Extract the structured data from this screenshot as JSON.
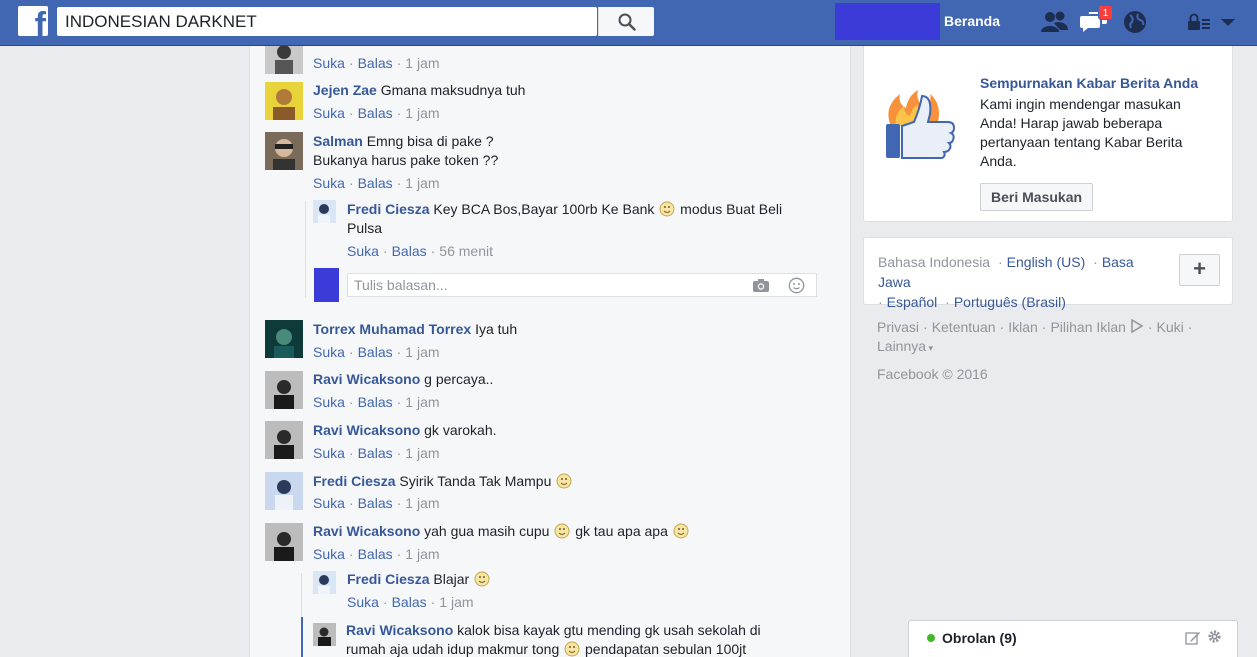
{
  "topbar": {
    "search_value": "INDONESIAN DARKNET",
    "home_label": "Beranda",
    "notification_count": "1",
    "brand_color": "#4267b2"
  },
  "comments": [
    {
      "author": "",
      "text": "",
      "actions": {
        "like": "Suka",
        "reply": "Balas",
        "time": "1 jam"
      }
    },
    {
      "author": "Jejen Zae",
      "text": "Gmana maksudnya tuh",
      "actions": {
        "like": "Suka",
        "reply": "Balas",
        "time": "1 jam"
      }
    },
    {
      "author": "Salman",
      "text": "Emng bisa di pake ?",
      "text2": "Bukanya harus pake token ??",
      "actions": {
        "like": "Suka",
        "reply": "Balas",
        "time": "1 jam"
      }
    },
    {
      "author": "Fredi Ciesza",
      "text_a": "Key BCA Bos,Bayar 100rb Ke Bank",
      "text_b": "modus Buat Beli",
      "text2": "Pulsa",
      "actions": {
        "like": "Suka",
        "reply": "Balas",
        "time": "56 menit"
      }
    },
    {
      "author": "Torrex Muhamad Torrex",
      "text": "Iya tuh",
      "actions": {
        "like": "Suka",
        "reply": "Balas",
        "time": "1 jam"
      }
    },
    {
      "author": "Ravi Wicaksono",
      "text": "g percaya..",
      "actions": {
        "like": "Suka",
        "reply": "Balas",
        "time": "1 jam"
      }
    },
    {
      "author": "Ravi Wicaksono",
      "text": "gk varokah.",
      "actions": {
        "like": "Suka",
        "reply": "Balas",
        "time": "1 jam"
      }
    },
    {
      "author": "Fredi Ciesza",
      "text": "Syirik Tanda Tak Mampu",
      "actions": {
        "like": "Suka",
        "reply": "Balas",
        "time": "1 jam"
      }
    },
    {
      "author": "Ravi Wicaksono",
      "text_a": "yah gua masih cupu",
      "text_b": "gk tau apa apa",
      "actions": {
        "like": "Suka",
        "reply": "Balas",
        "time": "1 jam"
      }
    },
    {
      "author": "Fredi Ciesza",
      "text": "Blajar",
      "actions": {
        "like": "Suka",
        "reply": "Balas",
        "time": "1 jam"
      }
    },
    {
      "author": "Ravi Wicaksono",
      "text": "kalok bisa kayak gtu mending gk usah sekolah di",
      "text2_a": "rumah aja udah idup makmur tong",
      "text2_b": "pendapatan sebulan 100jt"
    }
  ],
  "reply_box": {
    "placeholder": "Tulis balasan..."
  },
  "promo": {
    "title": "Sempurnakan Kabar Berita Anda",
    "text": "Kami ingin mendengar masukan Anda! Harap jawab beberapa pertanyaan tentang Kabar Berita Anda.",
    "button": "Beri Masukan"
  },
  "languages": {
    "current": "Bahasa Indonesia",
    "links": [
      "English (US)",
      "Basa Jawa",
      "Español",
      "Português (Brasil)"
    ],
    "add_label": "+"
  },
  "footer": {
    "links": [
      "Privasi",
      "Ketentuan",
      "Iklan",
      "Pilihan Iklan",
      "Kuki",
      "Lainnya"
    ],
    "copyright": "Facebook © 2016"
  },
  "chat": {
    "label": "Obrolan (9)",
    "status_color": "#42b72a"
  }
}
